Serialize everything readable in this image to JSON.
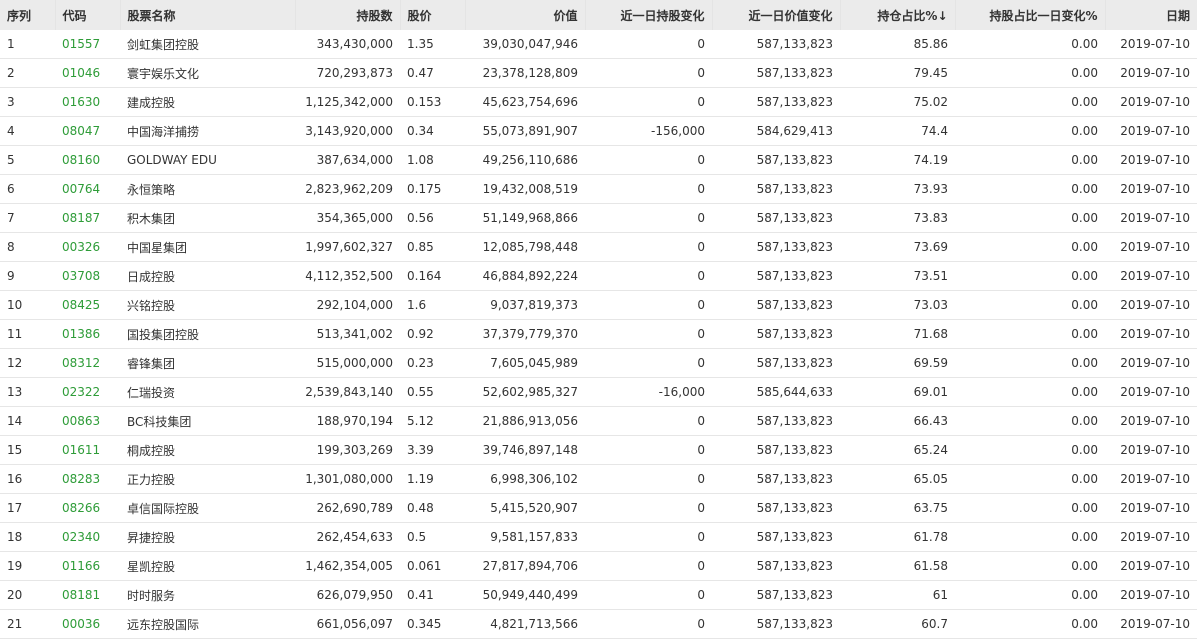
{
  "headers": {
    "seq": "序列",
    "code": "代码",
    "name": "股票名称",
    "shares": "持股数",
    "price": "股价",
    "value": "价值",
    "share_change": "近一日持股变化",
    "value_change": "近一日价值变化",
    "hold_pct": "持仓占比%",
    "hold_pct_sort_icon": "↓",
    "pct_change": "持股占比一日变化%",
    "date": "日期"
  },
  "colors": {
    "code_link": "#2e9c38",
    "header_bg": "#ebebeb"
  },
  "rows": [
    {
      "seq": "1",
      "code": "01557",
      "name": "剑虹集团控股",
      "shares": "343,430,000",
      "price": "1.35",
      "value": "39,030,047,946",
      "share_change": "0",
      "value_change": "587,133,823",
      "hold_pct": "85.86",
      "pct_change": "0.00",
      "date": "2019-07-10"
    },
    {
      "seq": "2",
      "code": "01046",
      "name": "寰宇娱乐文化",
      "shares": "720,293,873",
      "price": "0.47",
      "value": "23,378,128,809",
      "share_change": "0",
      "value_change": "587,133,823",
      "hold_pct": "79.45",
      "pct_change": "0.00",
      "date": "2019-07-10"
    },
    {
      "seq": "3",
      "code": "01630",
      "name": "建成控股",
      "shares": "1,125,342,000",
      "price": "0.153",
      "value": "45,623,754,696",
      "share_change": "0",
      "value_change": "587,133,823",
      "hold_pct": "75.02",
      "pct_change": "0.00",
      "date": "2019-07-10"
    },
    {
      "seq": "4",
      "code": "08047",
      "name": "中国海洋捕捞",
      "shares": "3,143,920,000",
      "price": "0.34",
      "value": "55,073,891,907",
      "share_change": "-156,000",
      "value_change": "584,629,413",
      "hold_pct": "74.4",
      "pct_change": "0.00",
      "date": "2019-07-10"
    },
    {
      "seq": "5",
      "code": "08160",
      "name": "GOLDWAY EDU",
      "shares": "387,634,000",
      "price": "1.08",
      "value": "49,256,110,686",
      "share_change": "0",
      "value_change": "587,133,823",
      "hold_pct": "74.19",
      "pct_change": "0.00",
      "date": "2019-07-10"
    },
    {
      "seq": "6",
      "code": "00764",
      "name": "永恒策略",
      "shares": "2,823,962,209",
      "price": "0.175",
      "value": "19,432,008,519",
      "share_change": "0",
      "value_change": "587,133,823",
      "hold_pct": "73.93",
      "pct_change": "0.00",
      "date": "2019-07-10"
    },
    {
      "seq": "7",
      "code": "08187",
      "name": "积木集团",
      "shares": "354,365,000",
      "price": "0.56",
      "value": "51,149,968,866",
      "share_change": "0",
      "value_change": "587,133,823",
      "hold_pct": "73.83",
      "pct_change": "0.00",
      "date": "2019-07-10"
    },
    {
      "seq": "8",
      "code": "00326",
      "name": "中国星集团",
      "shares": "1,997,602,327",
      "price": "0.85",
      "value": "12,085,798,448",
      "share_change": "0",
      "value_change": "587,133,823",
      "hold_pct": "73.69",
      "pct_change": "0.00",
      "date": "2019-07-10"
    },
    {
      "seq": "9",
      "code": "03708",
      "name": "日成控股",
      "shares": "4,112,352,500",
      "price": "0.164",
      "value": "46,884,892,224",
      "share_change": "0",
      "value_change": "587,133,823",
      "hold_pct": "73.51",
      "pct_change": "0.00",
      "date": "2019-07-10"
    },
    {
      "seq": "10",
      "code": "08425",
      "name": "兴铭控股",
      "shares": "292,104,000",
      "price": "1.6",
      "value": "9,037,819,373",
      "share_change": "0",
      "value_change": "587,133,823",
      "hold_pct": "73.03",
      "pct_change": "0.00",
      "date": "2019-07-10"
    },
    {
      "seq": "11",
      "code": "01386",
      "name": "国投集团控股",
      "shares": "513,341,002",
      "price": "0.92",
      "value": "37,379,779,370",
      "share_change": "0",
      "value_change": "587,133,823",
      "hold_pct": "71.68",
      "pct_change": "0.00",
      "date": "2019-07-10"
    },
    {
      "seq": "12",
      "code": "08312",
      "name": "睿锋集团",
      "shares": "515,000,000",
      "price": "0.23",
      "value": "7,605,045,989",
      "share_change": "0",
      "value_change": "587,133,823",
      "hold_pct": "69.59",
      "pct_change": "0.00",
      "date": "2019-07-10"
    },
    {
      "seq": "13",
      "code": "02322",
      "name": "仁瑞投资",
      "shares": "2,539,843,140",
      "price": "0.55",
      "value": "52,602,985,327",
      "share_change": "-16,000",
      "value_change": "585,644,633",
      "hold_pct": "69.01",
      "pct_change": "0.00",
      "date": "2019-07-10"
    },
    {
      "seq": "14",
      "code": "00863",
      "name": "BC科技集团",
      "shares": "188,970,194",
      "price": "5.12",
      "value": "21,886,913,056",
      "share_change": "0",
      "value_change": "587,133,823",
      "hold_pct": "66.43",
      "pct_change": "0.00",
      "date": "2019-07-10"
    },
    {
      "seq": "15",
      "code": "01611",
      "name": "桐成控股",
      "shares": "199,303,269",
      "price": "3.39",
      "value": "39,746,897,148",
      "share_change": "0",
      "value_change": "587,133,823",
      "hold_pct": "65.24",
      "pct_change": "0.00",
      "date": "2019-07-10"
    },
    {
      "seq": "16",
      "code": "08283",
      "name": "正力控股",
      "shares": "1,301,080,000",
      "price": "1.19",
      "value": "6,998,306,102",
      "share_change": "0",
      "value_change": "587,133,823",
      "hold_pct": "65.05",
      "pct_change": "0.00",
      "date": "2019-07-10"
    },
    {
      "seq": "17",
      "code": "08266",
      "name": "卓信国际控股",
      "shares": "262,690,789",
      "price": "0.48",
      "value": "5,415,520,907",
      "share_change": "0",
      "value_change": "587,133,823",
      "hold_pct": "63.75",
      "pct_change": "0.00",
      "date": "2019-07-10"
    },
    {
      "seq": "18",
      "code": "02340",
      "name": "昇捷控股",
      "shares": "262,454,633",
      "price": "0.5",
      "value": "9,581,157,833",
      "share_change": "0",
      "value_change": "587,133,823",
      "hold_pct": "61.78",
      "pct_change": "0.00",
      "date": "2019-07-10"
    },
    {
      "seq": "19",
      "code": "01166",
      "name": "星凯控股",
      "shares": "1,462,354,005",
      "price": "0.061",
      "value": "27,817,894,706",
      "share_change": "0",
      "value_change": "587,133,823",
      "hold_pct": "61.58",
      "pct_change": "0.00",
      "date": "2019-07-10"
    },
    {
      "seq": "20",
      "code": "08181",
      "name": "时时服务",
      "shares": "626,079,950",
      "price": "0.41",
      "value": "50,949,440,499",
      "share_change": "0",
      "value_change": "587,133,823",
      "hold_pct": "61",
      "pct_change": "0.00",
      "date": "2019-07-10"
    },
    {
      "seq": "21",
      "code": "00036",
      "name": "远东控股国际",
      "shares": "661,056,097",
      "price": "0.345",
      "value": "4,821,713,566",
      "share_change": "0",
      "value_change": "587,133,823",
      "hold_pct": "60.7",
      "pct_change": "0.00",
      "date": "2019-07-10"
    }
  ]
}
